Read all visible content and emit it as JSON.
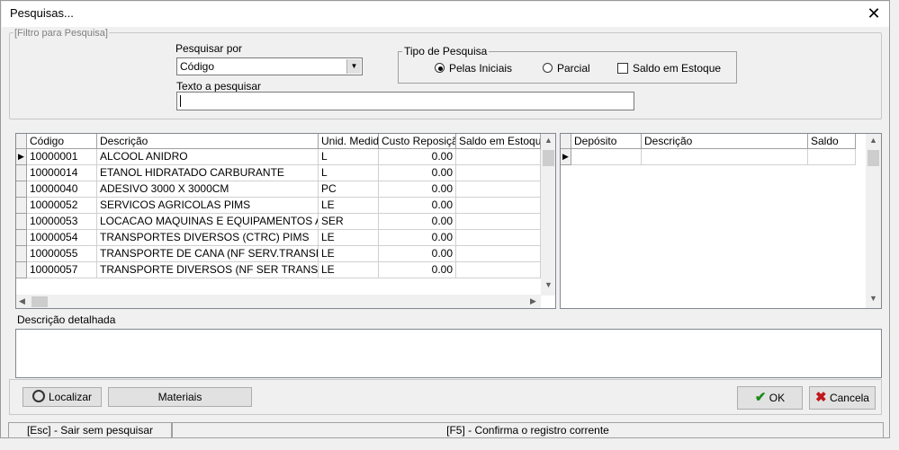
{
  "window": {
    "title": "Pesquisas..."
  },
  "filter": {
    "legend": "[Filtro para Pesquisa]",
    "search_by_label": "Pesquisar por",
    "search_by_value": "Código",
    "search_type_label": "Tipo de Pesquisa",
    "option_initials": "Pelas Iniciais",
    "option_partial": "Parcial",
    "option_stock": "Saldo em Estoque",
    "text_label": "Texto a pesquisar",
    "text_value": ""
  },
  "products": {
    "columns": [
      "Código",
      "Descrição",
      "Unid. Medida",
      "Custo Reposição",
      "Saldo em Estoque"
    ],
    "rows": [
      [
        "10000001",
        "ALCOOL ANIDRO",
        "L",
        "0.00",
        ""
      ],
      [
        "10000014",
        "ETANOL HIDRATADO CARBURANTE",
        "L",
        "0.00",
        ""
      ],
      [
        "10000040",
        "ADESIVO 3000 X 3000CM",
        "PC",
        "0.00",
        ""
      ],
      [
        "10000052",
        "SERVICOS AGRICOLAS PIMS",
        "LE",
        "0.00",
        ""
      ],
      [
        "10000053",
        "LOCACAO MAQUINAS E EQUIPAMENTOS AGRICOLAS",
        "SER",
        "0.00",
        ""
      ],
      [
        "10000054",
        "TRANSPORTES DIVERSOS (CTRC) PIMS",
        "LE",
        "0.00",
        ""
      ],
      [
        "10000055",
        "TRANSPORTE DE CANA (NF SERV.TRANSP) PIMS",
        "LE",
        "0.00",
        ""
      ],
      [
        "10000057",
        "TRANSPORTE DIVERSOS (NF SER TRANSP) PIMS",
        "LE",
        "0.00",
        ""
      ]
    ]
  },
  "deposits": {
    "columns": [
      "Depósito",
      "Descrição",
      "Saldo"
    ]
  },
  "detail": {
    "label": "Descrição detalhada",
    "value": ""
  },
  "buttons": {
    "search": "Localizar",
    "materials": "Materiais",
    "ok": "OK",
    "cancel": "Cancela"
  },
  "status": {
    "left": "[Esc] - Sair sem pesquisar",
    "right": "[F5] - Confirma o registro corrente"
  },
  "colors": {
    "ok": "#1a8a1a",
    "cancel": "#c0161c"
  }
}
